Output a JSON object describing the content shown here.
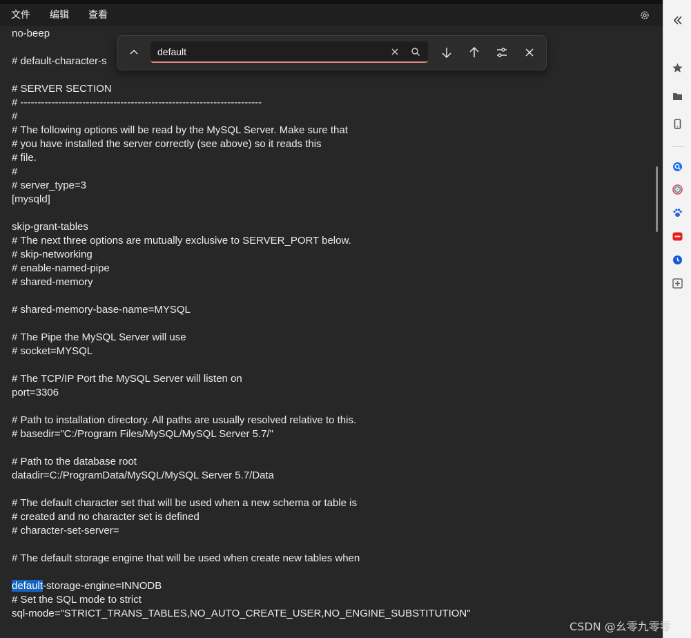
{
  "menubar": {
    "items": [
      "文件",
      "编辑",
      "查看"
    ]
  },
  "findbar": {
    "query": "default"
  },
  "editor": {
    "lines": [
      "no-beep",
      "",
      "# default-character-s",
      "",
      "# SERVER SECTION",
      "# ----------------------------------------------------------------------",
      "#",
      "# The following options will be read by the MySQL Server. Make sure that",
      "# you have installed the server correctly (see above) so it reads this",
      "# file.",
      "#",
      "# server_type=3",
      "[mysqld]",
      "",
      "skip-grant-tables",
      "# The next three options are mutually exclusive to SERVER_PORT below.",
      "# skip-networking",
      "# enable-named-pipe",
      "# shared-memory",
      "",
      "# shared-memory-base-name=MYSQL",
      "",
      "# The Pipe the MySQL Server will use",
      "# socket=MYSQL",
      "",
      "# The TCP/IP Port the MySQL Server will listen on",
      "port=3306",
      "",
      "# Path to installation directory. All paths are usually resolved relative to this.",
      "# basedir=\"C:/Program Files/MySQL/MySQL Server 5.7/\"",
      "",
      "# Path to the database root",
      "datadir=C:/ProgramData/MySQL/MySQL Server 5.7/Data",
      "",
      "# The default character set that will be used when a new schema or table is",
      "# created and no character set is defined",
      "# character-set-server=",
      "",
      "# The default storage engine that will be used when create new tables when",
      "",
      "",
      "# Set the SQL mode to strict",
      "sql-mode=\"STRICT_TRANS_TABLES,NO_AUTO_CREATE_USER,NO_ENGINE_SUBSTITUTION\""
    ],
    "match_line": {
      "highlight": "default",
      "rest": "-storage-engine=INNODB"
    }
  },
  "watermark": "CSDN @幺零九零零",
  "colors": {
    "accent": "#1565c0",
    "search_underline": "#e38680",
    "background": "#272727"
  },
  "sidebar_icons": [
    "collapse-icon",
    "star-icon",
    "folder-icon",
    "phone-icon",
    "search-app-icon",
    "circle-app-icon",
    "paw-icon",
    "badge-app-icon",
    "clock-icon",
    "add-icon"
  ]
}
